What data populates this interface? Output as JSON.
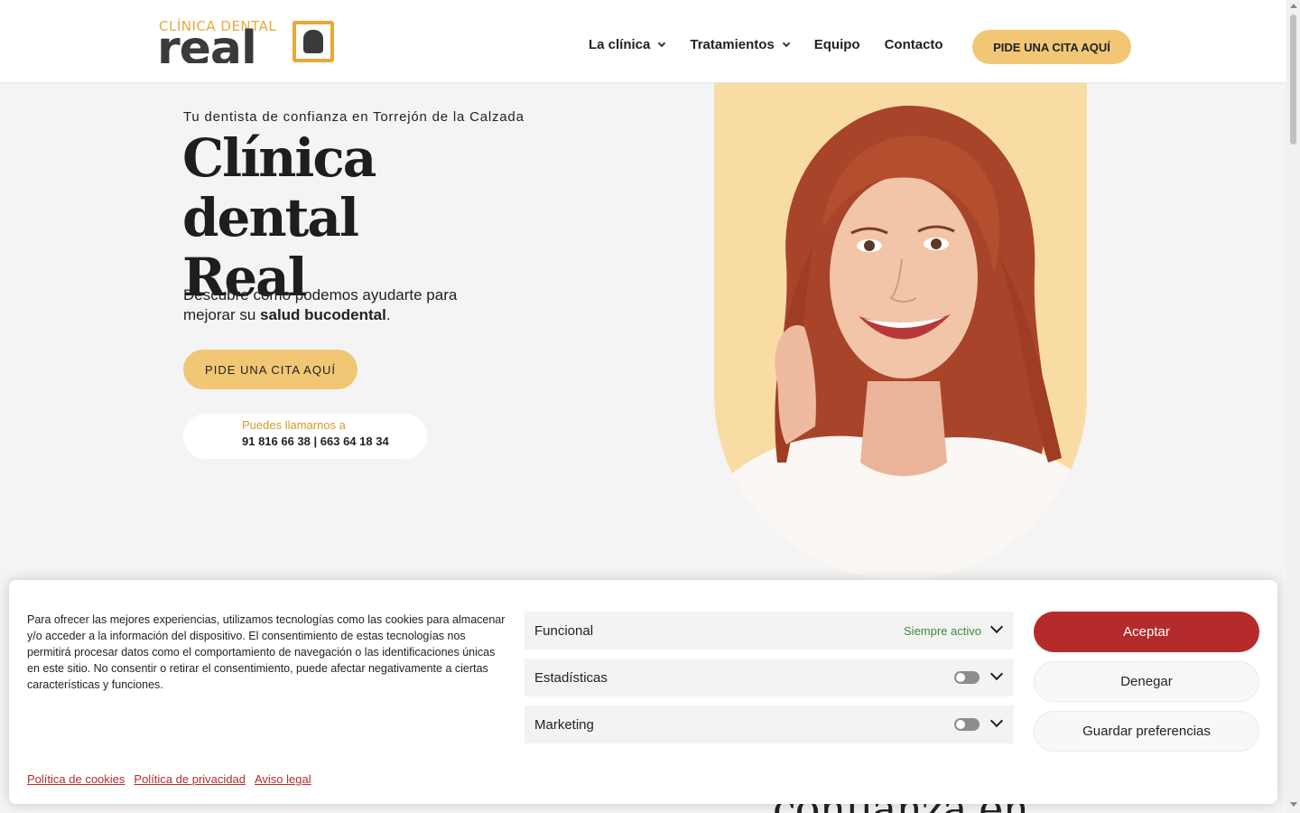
{
  "header": {
    "logo": {
      "top_text": "CLÍNICA DENTAL",
      "main_text": "real"
    },
    "nav": [
      {
        "label": "La clínica",
        "has_dropdown": true
      },
      {
        "label": "Tratamientos",
        "has_dropdown": true
      },
      {
        "label": "Equipo",
        "has_dropdown": false
      },
      {
        "label": "Contacto",
        "has_dropdown": false
      }
    ],
    "cta_label": "PIDE UNA CITA AQUÍ"
  },
  "hero": {
    "subtitle": "Tu dentista de confianza en Torrejón de la Calzada",
    "title_line1": "Clínica dental",
    "title_line2": "Real",
    "desc_part1": "Descubre como podemos ayudarte para mejorar su ",
    "desc_bold": "salud bucodental",
    "desc_end": ".",
    "cta_label": "PIDE UNA CITA AQUÍ",
    "phone_label": "Puedes llamarnos a",
    "phone_numbers": "91 816 66 38 | 663 64 18 34"
  },
  "below_fold_text": "confianza en",
  "cookie": {
    "text": "Para ofrecer las mejores experiencias, utilizamos tecnologías como las cookies para almacenar y/o acceder a la información del dispositivo. El consentimiento de estas tecnologías nos permitirá procesar datos como el comportamiento de navegación o las identificaciones únicas en este sitio. No consentir o retirar el consentimiento, puede afectar negativamente a ciertas características y funciones.",
    "categories": [
      {
        "name": "Funcional",
        "status": "Siempre activo"
      },
      {
        "name": "Estadísticas",
        "enabled": false
      },
      {
        "name": "Marketing",
        "enabled": false
      }
    ],
    "buttons": {
      "accept": "Aceptar",
      "deny": "Denegar",
      "save": "Guardar preferencias"
    },
    "links": [
      "Política de cookies",
      "Política de privacidad",
      "Aviso legal"
    ]
  },
  "colors": {
    "accent_gold": "#f1c776",
    "logo_gold": "#e6a93a",
    "hero_image_bg": "#f8dca4",
    "cookie_red": "#b52b2b",
    "status_green": "#3b8a3b"
  },
  "icons": {
    "nav_dropdown": "chevron-down-icon",
    "category_expand": "chevron-down-icon",
    "category_toggle": "toggle-switch-icon"
  }
}
